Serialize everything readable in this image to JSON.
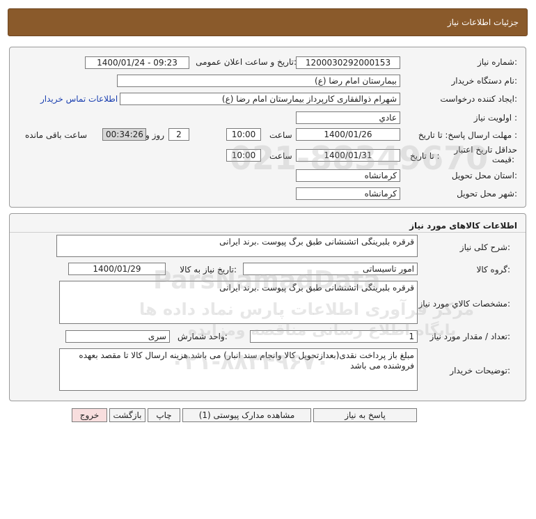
{
  "header": {
    "title": "جزئیات اطلاعات نیاز"
  },
  "info": {
    "need_number_label": "شماره نیاز:",
    "need_number": "1200030292000153",
    "announce_label": "تاریخ و ساعت اعلان عمومی:",
    "announce_value": "1400/01/24 - 09:23",
    "buyer_org_label": "نام دستگاه خریدار:",
    "buyer_org": "بیمارستان امام رضا (ع)",
    "creator_label": "ایجاد کننده درخواست:",
    "creator": "شهرام ذوالفقاری کارپرداز بیمارستان امام رضا (ع)",
    "contact_link": "اطلاعات تماس خریدار",
    "priority_label": "اولویت نیاز :",
    "priority": "عادي",
    "deadline_label": "مهلت ارسال پاسخ: تا تاریخ :",
    "deadline_date": "1400/01/26",
    "time_label": "ساعت",
    "deadline_time": "10:00",
    "days_value": "2",
    "days_label": "روز و",
    "remaining_time": "00:34:26",
    "remaining_label": "ساعت باقی مانده",
    "validity_label_1": "حداقل تاریخ اعتبار",
    "validity_label_2": "قیمت:",
    "validity_to_label": "تا تاریخ :",
    "validity_date": "1400/01/31",
    "validity_time_label": "ساعت",
    "validity_time": "10:00",
    "province_label": "استان محل تحویل:",
    "province": "کرمانشاه",
    "city_label": "شهر محل تحویل:",
    "city": "کرمانشاه"
  },
  "goods": {
    "section_title": "اطلاعات کالاهای مورد نیاز",
    "general_desc_label": "شرح کلی نیاز:",
    "general_desc": "قرقره بلبرینگی اتشنشانی طبق برگ پیوست .برند ایرانی",
    "group_label": "گروه کالا:",
    "group_value": "امور تاسیساتی",
    "need_date_label": "تاریخ نیاز به کالا:",
    "need_date": "1400/01/29",
    "specs_label": "مشخصات کالاي مورد نیاز:",
    "specs": "قرقره بلبرینگی اتشنشانی طبق برگ پیوست .برند ایرانی",
    "qty_label": "تعداد / مقدار مورد نیاز:",
    "qty": "1",
    "unit_label": "واحد شمارش:",
    "unit": "سری",
    "buyer_notes_label": "توضیحات خریدار:",
    "buyer_notes": "مبلغ باز پرداخت نقدی(بعدازتحویل کالا وانجام سند انبار) می باشد.هزینه ارسال کالا تا مقصد بعهده فروشنده می باشد"
  },
  "buttons": {
    "reply": "پاسخ به نیاز",
    "attachments": "مشاهده مدارک پیوستی (1)",
    "print": "چاپ",
    "back": "بازگشت",
    "exit": "خروج"
  },
  "watermark": {
    "brand": "ParsNamadData",
    "line1": "مرکز فرآوری اطلاعات پارس نماد داده ها",
    "line2": "پایگاه اطلاع رسانی مناقصه ومزایده",
    "phone": "۰۲۱-۸۸۳۴۹۶۷۰",
    "number": "021-88349670"
  },
  "colors": {
    "header_bg": "#8a5a2b",
    "link": "#1a3fb0",
    "exit_button_bg": "#f8dede"
  }
}
